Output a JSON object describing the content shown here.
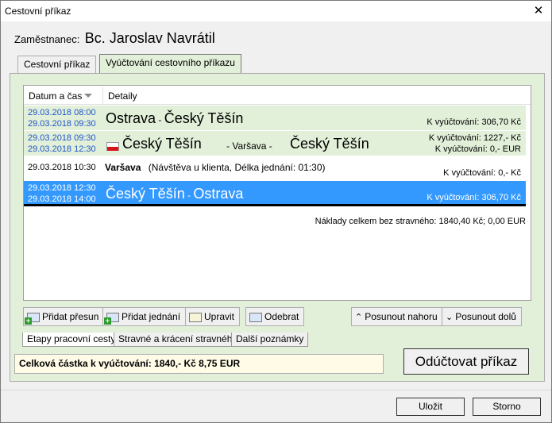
{
  "window": {
    "title": "Cestovní příkaz"
  },
  "employee": {
    "label": "Zaměstnanec:",
    "name": "Bc. Jaroslav Navrátil"
  },
  "tabs": [
    "Cestovní příkaz",
    "Vyúčtování cestovního příkazu"
  ],
  "list": {
    "headers": {
      "datetime": "Datum a čas",
      "details": "Detaily"
    },
    "rows": [
      {
        "dt1": "29.03.2018  08:00",
        "dt2": "29.03.2018  09:30",
        "from": "Ostrava",
        "sep": " - ",
        "to": "Český Těšín",
        "amount": "K vyúčtování: 306,70 Kč"
      },
      {
        "dt1": "29.03.2018  09:30",
        "dt2": "29.03.2018  12:30",
        "from": "Český Těšín",
        "via": "- Varšava -",
        "to": "Český Těšín",
        "amount1": "K vyúčtování: 1227,- Kč",
        "amount2": "K vyúčtování: 0,- EUR"
      },
      {
        "dt": "29.03.2018   10:30",
        "place": "Varšava",
        "note": "(Návštěva u klienta, Délka jednání: 01:30)",
        "amount": "K vyúčtování: 0,- Kč"
      },
      {
        "dt1": "29.03.2018  12:30",
        "dt2": "29.03.2018  14:00",
        "from": "Český Těšín",
        "sep": " - ",
        "to": "Ostrava",
        "amount": "K vyúčtování: 306,70 Kč"
      }
    ],
    "total": "Náklady celkem bez stravného: 1840,40 Kč; 0,00 EUR"
  },
  "buttons": {
    "add_transfer": "Přidat přesun",
    "add_meeting": "Přidat jednání",
    "edit": "Upravit",
    "remove": "Odebrat",
    "move_up": "Posunout nahoru",
    "move_down": "Posunout dolů"
  },
  "subtabs": [
    "Etapy pracovní cesty",
    "Stravné a krácení stravného",
    "Další poznámky"
  ],
  "summary": "Celková částka k vyúčtování: 1840,- Kč 8,75 EUR",
  "settle_button": "Odúčtovat příkaz",
  "footer": {
    "save": "Uložit",
    "cancel": "Storno"
  },
  "colors": {
    "panel": "#e2efd9",
    "selected": "#3399ff",
    "date_blue": "#1e56c8",
    "flag_red": "#d7141a"
  }
}
